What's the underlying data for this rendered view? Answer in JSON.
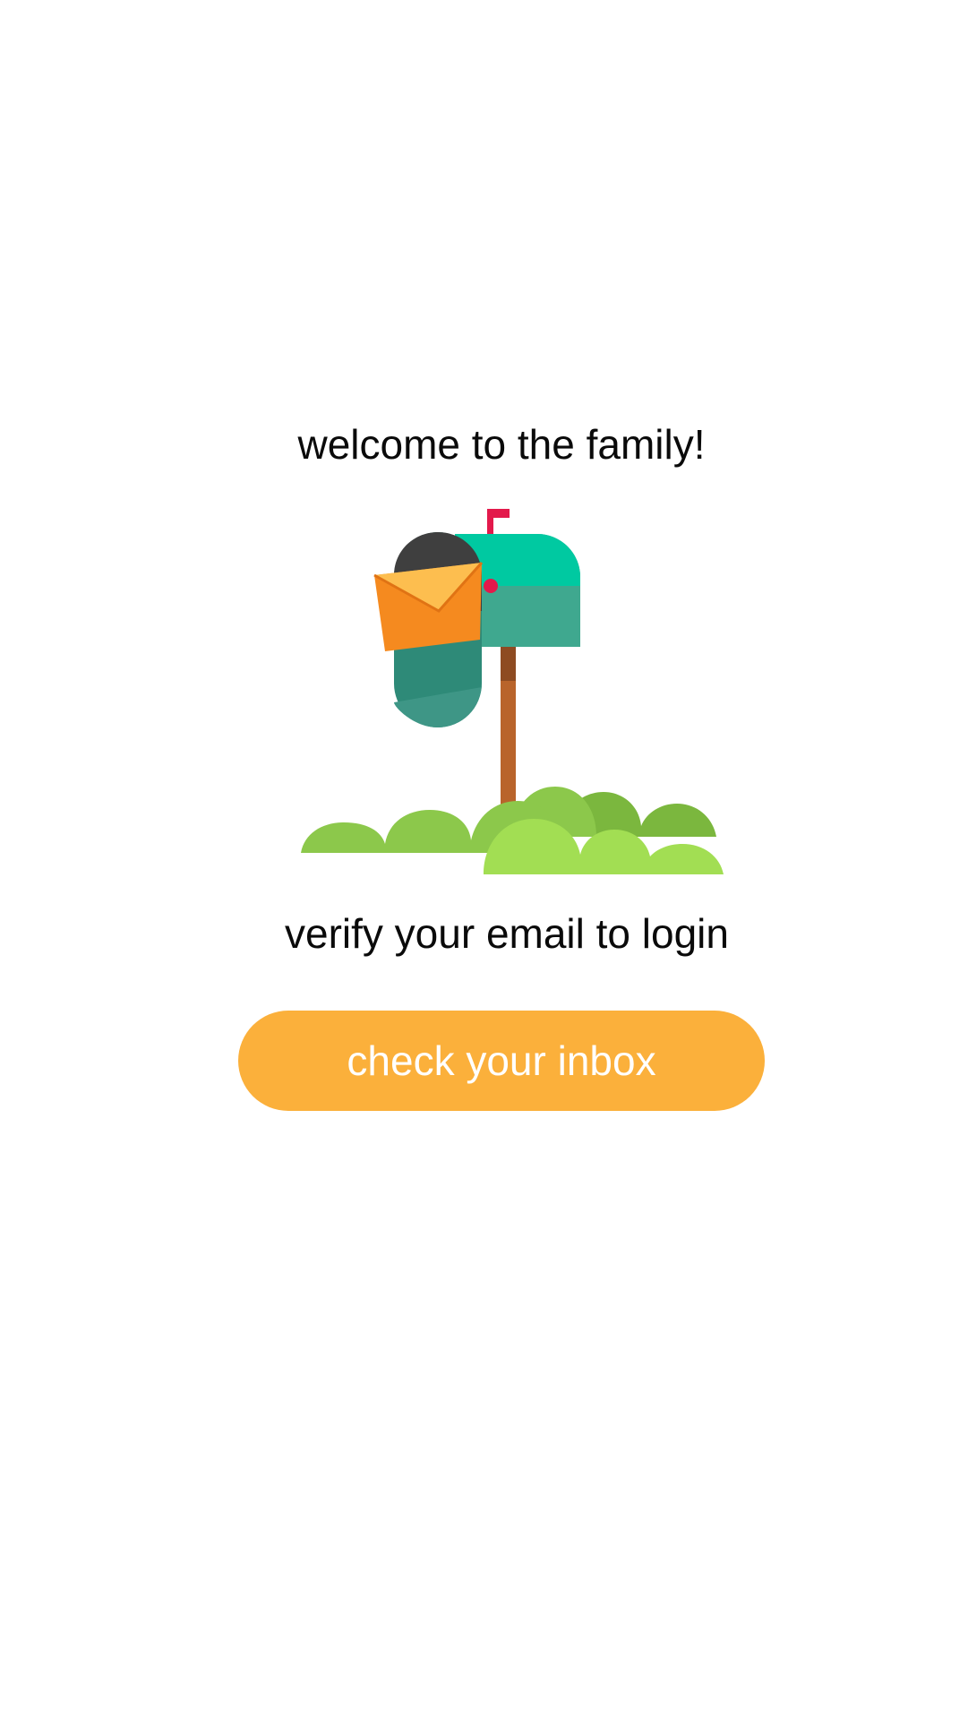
{
  "screen": {
    "title": "welcome to the family!",
    "subtitle": "verify your email to login",
    "primary_button_label": "check your inbox"
  },
  "illustration": {
    "name": "mailbox-icon",
    "colors": {
      "mailbox_teal": "#3FA88F",
      "mailbox_teal_top": "#00C9A1",
      "mailbox_dark_teal": "#2E8A78",
      "door_dark": "#3F3F3F",
      "flag_red": "#E3194B",
      "envelope_orange": "#F58A1F",
      "envelope_flap": "#FDBE4F",
      "post_brown": "#B9642B",
      "bush_light": "#A2DE53",
      "bush_mid": "#8CC84B",
      "bush_dark": "#7BB73E"
    }
  },
  "theme": {
    "accent": "#FBB03B",
    "text": "#0a0a0a",
    "background": "#ffffff"
  }
}
